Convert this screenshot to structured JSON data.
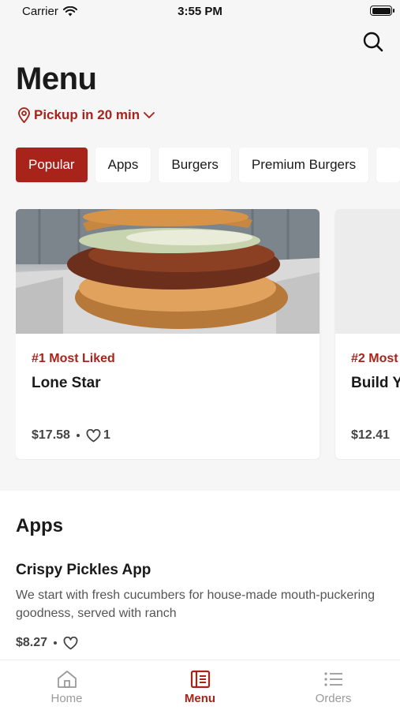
{
  "status_bar": {
    "carrier": "Carrier",
    "time": "3:55 PM"
  },
  "header": {
    "title": "Menu",
    "pickup_label": "Pickup in 20 min"
  },
  "categories": [
    {
      "label": "Popular",
      "active": true
    },
    {
      "label": "Apps",
      "active": false
    },
    {
      "label": "Burgers",
      "active": false
    },
    {
      "label": "Premium Burgers",
      "active": false
    }
  ],
  "featured": [
    {
      "tag": "#1 Most Liked",
      "name": "Lone Star",
      "price": "$17.58",
      "likes": "1"
    },
    {
      "tag": "#2 Most",
      "name": "Build Y",
      "price": "$12.41"
    }
  ],
  "apps_section": {
    "title": "Apps",
    "item": {
      "name": "Crispy Pickles App",
      "description": "We start with fresh cucumbers for house-made mouth-puckering goodness, served with ranch",
      "price": "$8.27"
    }
  },
  "tabbar": [
    {
      "label": "Home",
      "icon": "home-icon",
      "active": false
    },
    {
      "label": "Menu",
      "icon": "menu-book-icon",
      "active": true
    },
    {
      "label": "Orders",
      "icon": "list-icon",
      "active": false
    }
  ],
  "colors": {
    "accent": "#a8231a",
    "background": "#f6f6f6",
    "card": "#ffffff"
  }
}
